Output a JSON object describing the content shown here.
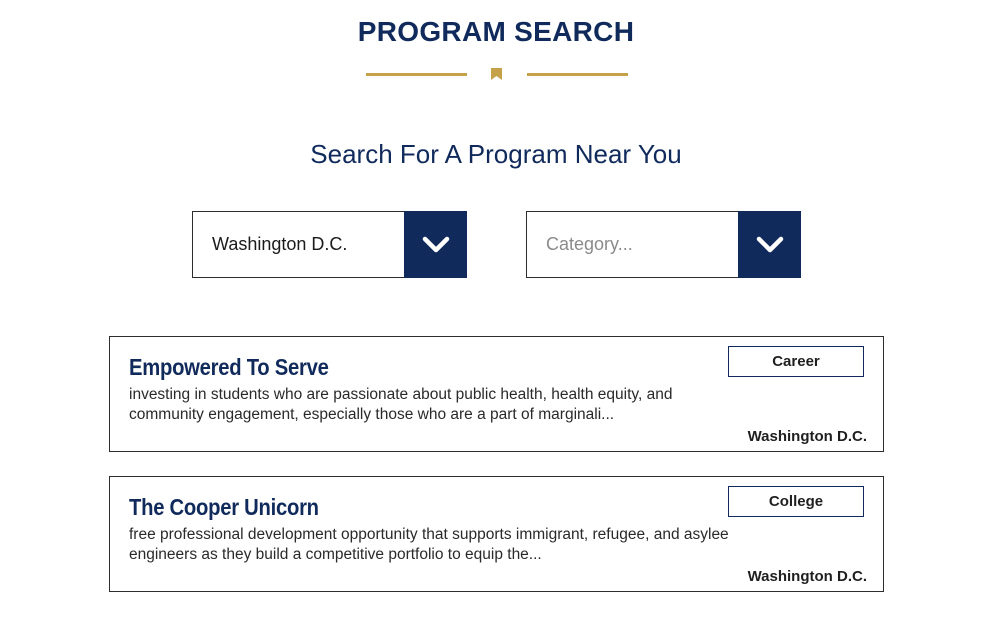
{
  "header": {
    "title": "PROGRAM SEARCH",
    "subtitle": "Search For A Program Near You",
    "accent_color": "#c5a24a",
    "brand_color": "#112a5c"
  },
  "filters": {
    "location": {
      "value": "Washington D.C.",
      "icon": "chevron-down-icon"
    },
    "category": {
      "placeholder": "Category...",
      "icon": "chevron-down-icon"
    }
  },
  "programs": [
    {
      "name": "Empowered To Serve",
      "description": "investing in students who are passionate about public health, health equity, and community engagement, especially those who are a part of marginali...",
      "tag": "Career",
      "location": "Washington D.C."
    },
    {
      "name": "The Cooper Unicorn",
      "description": "free professional development opportunity that supports immigrant, refugee, and asylee engineers as they build a competitive portfolio to equip the...",
      "tag": "College",
      "location": "Washington D.C."
    }
  ]
}
